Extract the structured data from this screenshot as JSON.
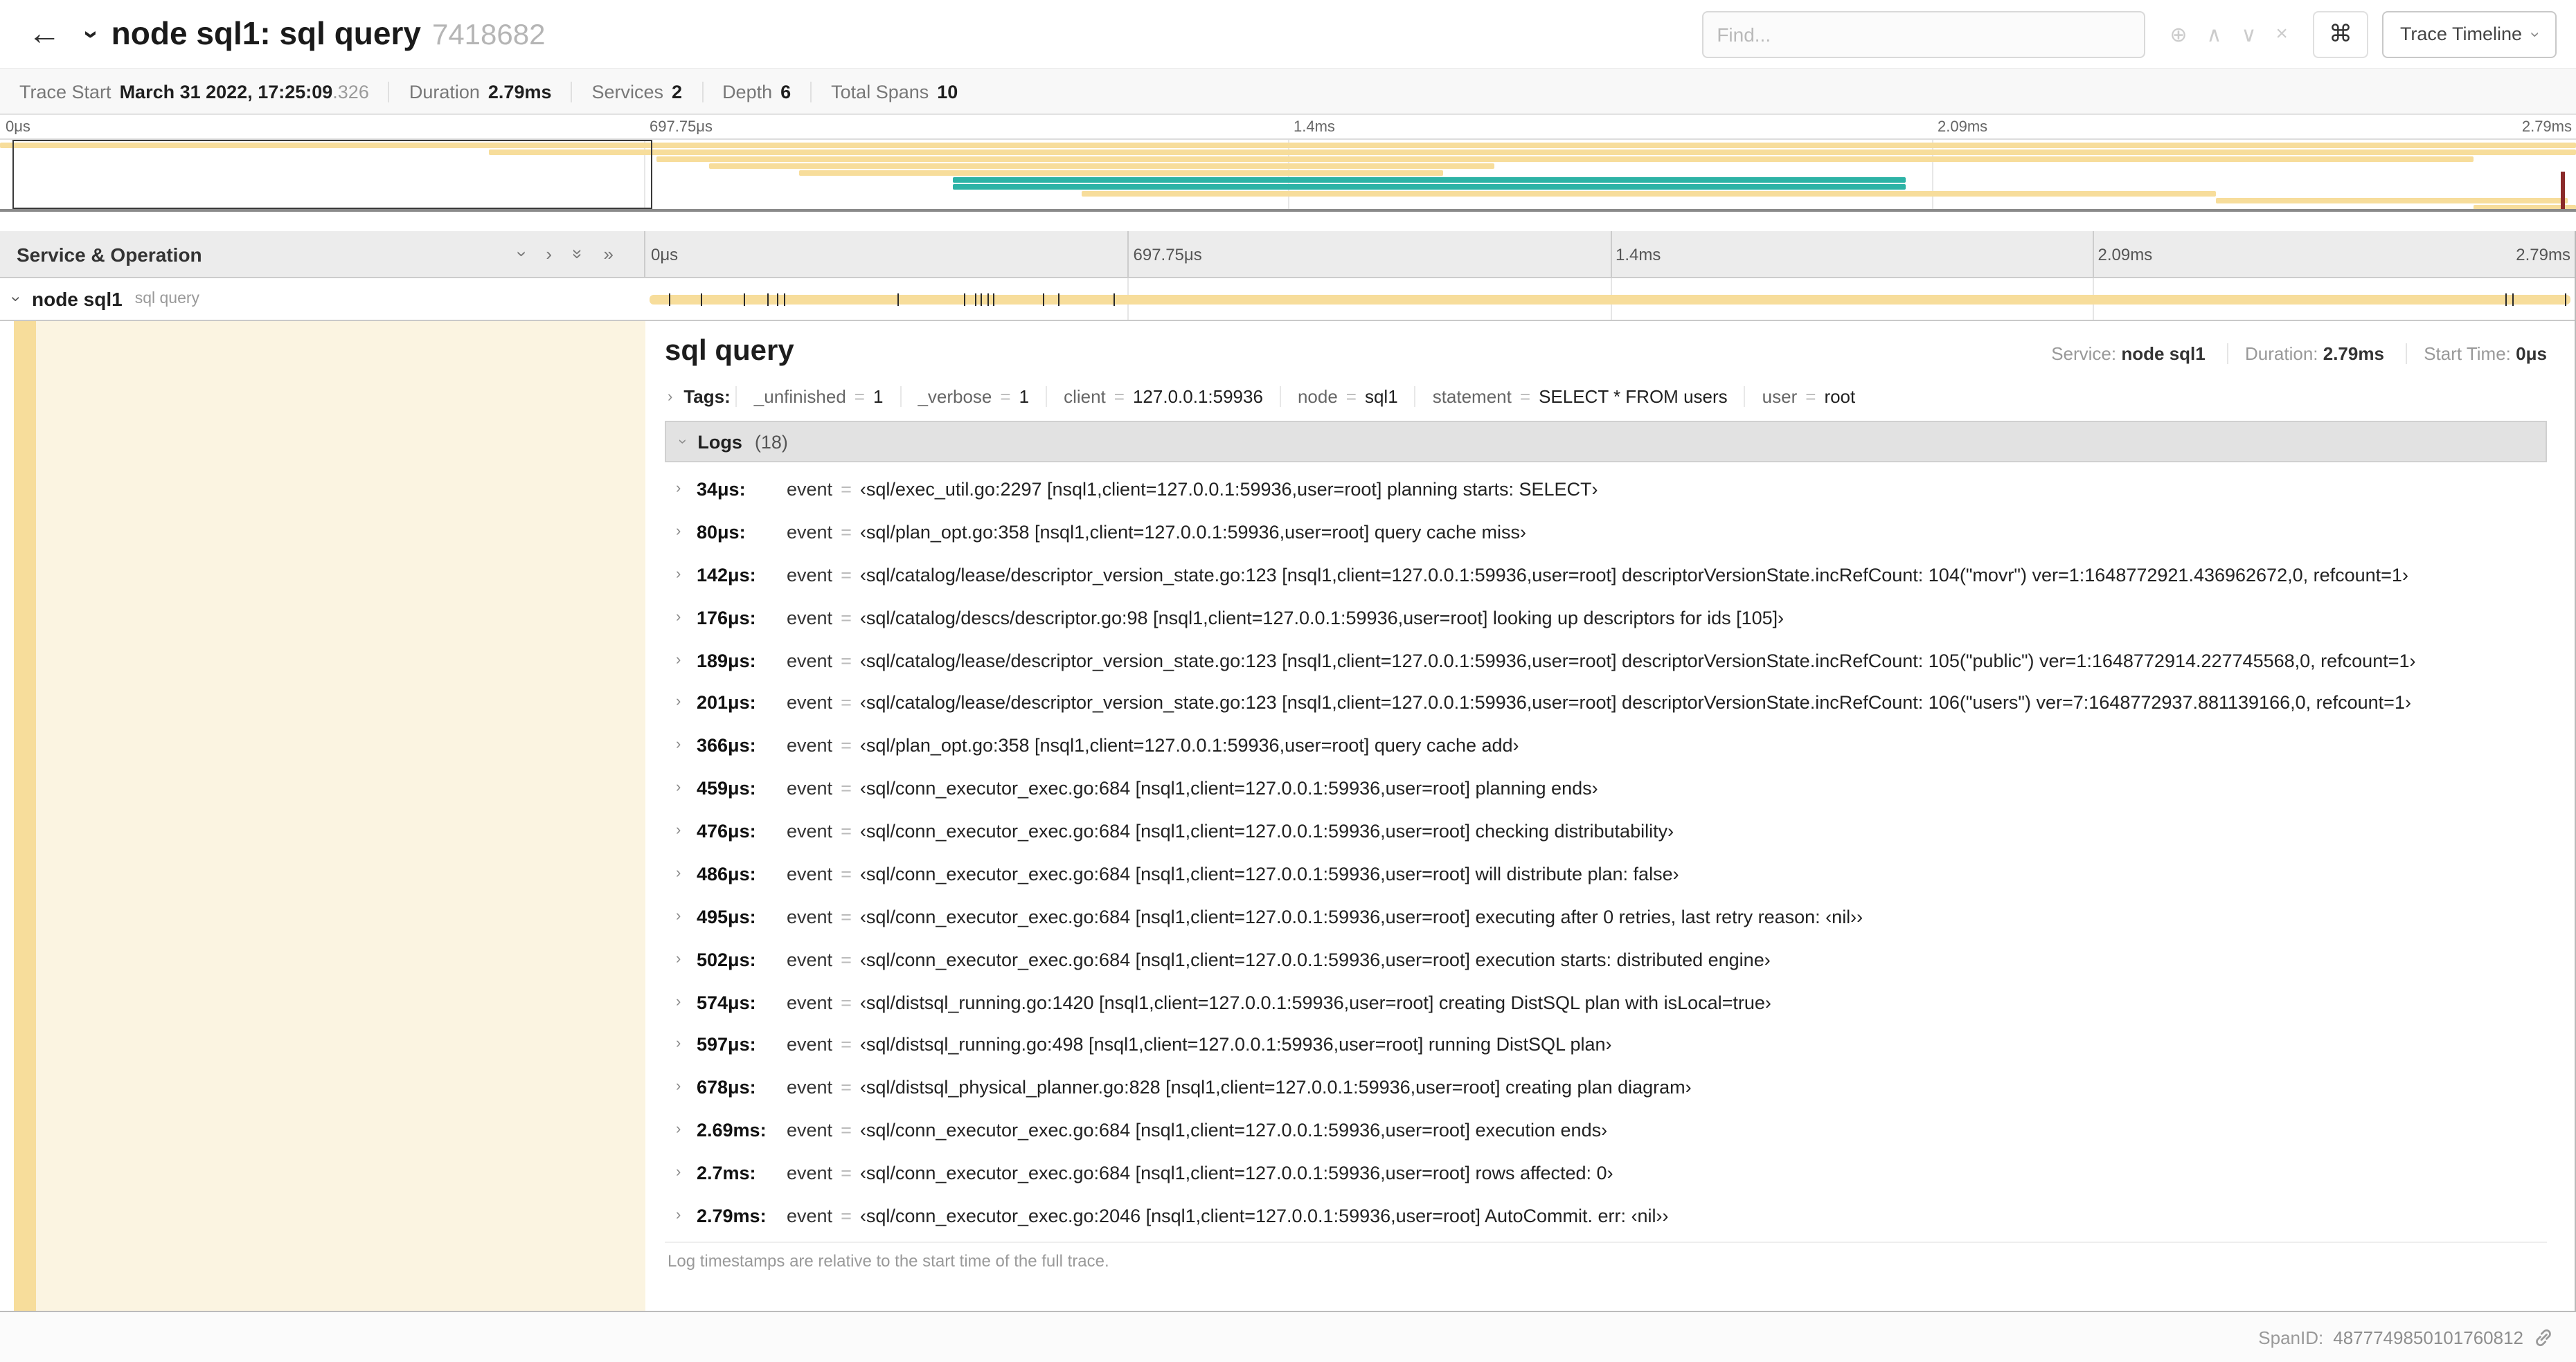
{
  "icons": {
    "back": "←",
    "chevron": "›",
    "double_chevron": "»",
    "circle_plus": "⊕",
    "up": "∧",
    "down": "∨",
    "close": "×",
    "command": "⌘",
    "eq": "="
  },
  "colors": {
    "tan": "#f7dd9b",
    "teal": "#2db3a6",
    "indent_fill": "#fbf4e1"
  },
  "header": {
    "title": "node sql1: sql query",
    "trace_id": "7418682",
    "find_placeholder": "Find...",
    "view_label": "Trace Timeline"
  },
  "summary": {
    "items": [
      {
        "label": "Trace Start",
        "value": "March 31 2022, 17:25:09",
        "suffix": ".326"
      },
      {
        "label": "Duration",
        "value": "2.79ms",
        "suffix": ""
      },
      {
        "label": "Services",
        "value": "2",
        "suffix": ""
      },
      {
        "label": "Depth",
        "value": "6",
        "suffix": ""
      },
      {
        "label": "Total Spans",
        "value": "10",
        "suffix": ""
      }
    ]
  },
  "minimap": {
    "gridline_pcts": [
      25,
      50,
      75
    ],
    "selection": {
      "start": 0.5,
      "end": 25.3
    },
    "scrubber_pct": 99.4,
    "spans": [
      {
        "start": 0,
        "end": 100,
        "color": "tan"
      },
      {
        "start": 19,
        "end": 100,
        "color": "tan"
      },
      {
        "start": 25.5,
        "end": 96,
        "color": "tan"
      },
      {
        "start": 27.5,
        "end": 58,
        "color": "tan"
      },
      {
        "start": 31,
        "end": 56,
        "color": "tan"
      },
      {
        "start": 37,
        "end": 74,
        "color": "teal"
      },
      {
        "start": 37,
        "end": 74,
        "color": "teal"
      },
      {
        "start": 42,
        "end": 86,
        "color": "tan"
      },
      {
        "start": 86,
        "end": 99.7,
        "color": "tan"
      },
      {
        "start": 96,
        "end": 100,
        "color": "tan"
      }
    ]
  },
  "timeline": {
    "left_header": "Service & Operation",
    "ticks": [
      "0μs",
      "697.75μs",
      "1.4ms",
      "2.09ms",
      "2.79ms"
    ],
    "span": {
      "service": "node sql1",
      "operation": "sql query",
      "bar_start_pct": 0.2,
      "bar_end_pct": 99.8,
      "log_marker_pcts": [
        1.2,
        2.9,
        5.1,
        6.3,
        6.8,
        7.2,
        13.1,
        16.5,
        17.1,
        17.4,
        17.7,
        18.0,
        20.6,
        21.4,
        24.3,
        96.4,
        96.8,
        99.5
      ]
    }
  },
  "detail": {
    "title": "sql query",
    "service_label": "Service:",
    "service_value": "node sql1",
    "duration_label": "Duration:",
    "duration_value": "2.79ms",
    "start_time_label": "Start Time:",
    "start_time_value": "0μs",
    "tags_label": "Tags:",
    "tags": [
      {
        "key": "_unfinished",
        "value": "1"
      },
      {
        "key": "_verbose",
        "value": "1"
      },
      {
        "key": "client",
        "value": "127.0.0.1:59936"
      },
      {
        "key": "node",
        "value": "sql1"
      },
      {
        "key": "statement",
        "value": "SELECT * FROM users"
      },
      {
        "key": "user",
        "value": "root"
      }
    ],
    "logs_label": "Logs",
    "logs_count": "(18)",
    "logs": [
      {
        "time": "34μs:",
        "key": "event",
        "value": "‹sql/exec_util.go:2297 [nsql1,client=127.0.0.1:59936,user=root] planning starts: SELECT›"
      },
      {
        "time": "80μs:",
        "key": "event",
        "value": "‹sql/plan_opt.go:358 [nsql1,client=127.0.0.1:59936,user=root] query cache miss›"
      },
      {
        "time": "142μs:",
        "key": "event",
        "value": "‹sql/catalog/lease/descriptor_version_state.go:123 [nsql1,client=127.0.0.1:59936,user=root] descriptorVersionState.incRefCount: 104(\"movr\") ver=1:1648772921.436962672,0, refcount=1›"
      },
      {
        "time": "176μs:",
        "key": "event",
        "value": "‹sql/catalog/descs/descriptor.go:98 [nsql1,client=127.0.0.1:59936,user=root] looking up descriptors for ids [105]›"
      },
      {
        "time": "189μs:",
        "key": "event",
        "value": "‹sql/catalog/lease/descriptor_version_state.go:123 [nsql1,client=127.0.0.1:59936,user=root] descriptorVersionState.incRefCount: 105(\"public\") ver=1:1648772914.227745568,0, refcount=1›"
      },
      {
        "time": "201μs:",
        "key": "event",
        "value": "‹sql/catalog/lease/descriptor_version_state.go:123 [nsql1,client=127.0.0.1:59936,user=root] descriptorVersionState.incRefCount: 106(\"users\") ver=7:1648772937.881139166,0, refcount=1›"
      },
      {
        "time": "366μs:",
        "key": "event",
        "value": "‹sql/plan_opt.go:358 [nsql1,client=127.0.0.1:59936,user=root] query cache add›"
      },
      {
        "time": "459μs:",
        "key": "event",
        "value": "‹sql/conn_executor_exec.go:684 [nsql1,client=127.0.0.1:59936,user=root] planning ends›"
      },
      {
        "time": "476μs:",
        "key": "event",
        "value": "‹sql/conn_executor_exec.go:684 [nsql1,client=127.0.0.1:59936,user=root] checking distributability›"
      },
      {
        "time": "486μs:",
        "key": "event",
        "value": "‹sql/conn_executor_exec.go:684 [nsql1,client=127.0.0.1:59936,user=root] will distribute plan: false›"
      },
      {
        "time": "495μs:",
        "key": "event",
        "value": "‹sql/conn_executor_exec.go:684 [nsql1,client=127.0.0.1:59936,user=root] executing after 0 retries, last retry reason: ‹nil››"
      },
      {
        "time": "502μs:",
        "key": "event",
        "value": "‹sql/conn_executor_exec.go:684 [nsql1,client=127.0.0.1:59936,user=root] execution starts: distributed engine›"
      },
      {
        "time": "574μs:",
        "key": "event",
        "value": "‹sql/distsql_running.go:1420 [nsql1,client=127.0.0.1:59936,user=root] creating DistSQL plan with isLocal=true›"
      },
      {
        "time": "597μs:",
        "key": "event",
        "value": "‹sql/distsql_running.go:498 [nsql1,client=127.0.0.1:59936,user=root] running DistSQL plan›"
      },
      {
        "time": "678μs:",
        "key": "event",
        "value": "‹sql/distsql_physical_planner.go:828 [nsql1,client=127.0.0.1:59936,user=root] creating plan diagram›"
      },
      {
        "time": "2.69ms:",
        "key": "event",
        "value": "‹sql/conn_executor_exec.go:684 [nsql1,client=127.0.0.1:59936,user=root] execution ends›"
      },
      {
        "time": "2.7ms:",
        "key": "event",
        "value": "‹sql/conn_executor_exec.go:684 [nsql1,client=127.0.0.1:59936,user=root] rows affected: 0›"
      },
      {
        "time": "2.79ms:",
        "key": "event",
        "value": "‹sql/conn_executor_exec.go:2046 [nsql1,client=127.0.0.1:59936,user=root] AutoCommit. err: ‹nil››"
      }
    ],
    "footer_note": "Log timestamps are relative to the start time of the full trace."
  },
  "footer": {
    "spanid_label": "SpanID:",
    "spanid_value": "4877749850101760812"
  }
}
